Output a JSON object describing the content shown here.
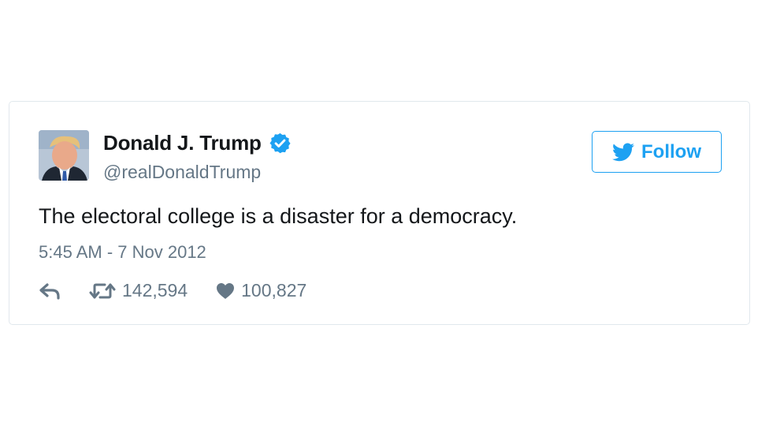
{
  "tweet": {
    "author_name": "Donald J. Trump",
    "author_handle": "@realDonaldTrump",
    "verified": true,
    "follow_label": "Follow",
    "text": "The electoral college is a disaster for a democracy.",
    "timestamp": "5:45 AM - 7 Nov 2012",
    "retweet_count": "142,594",
    "like_count": "100,827"
  },
  "icons": {
    "verified": "verified-badge-icon",
    "follow": "twitter-bird-icon",
    "reply": "reply-arrow-icon",
    "retweet": "retweet-icon",
    "like": "heart-icon"
  },
  "colors": {
    "brand_blue": "#1da1f2",
    "text_primary": "#14171a",
    "text_secondary": "#657786",
    "card_border": "#e1e8ed"
  }
}
